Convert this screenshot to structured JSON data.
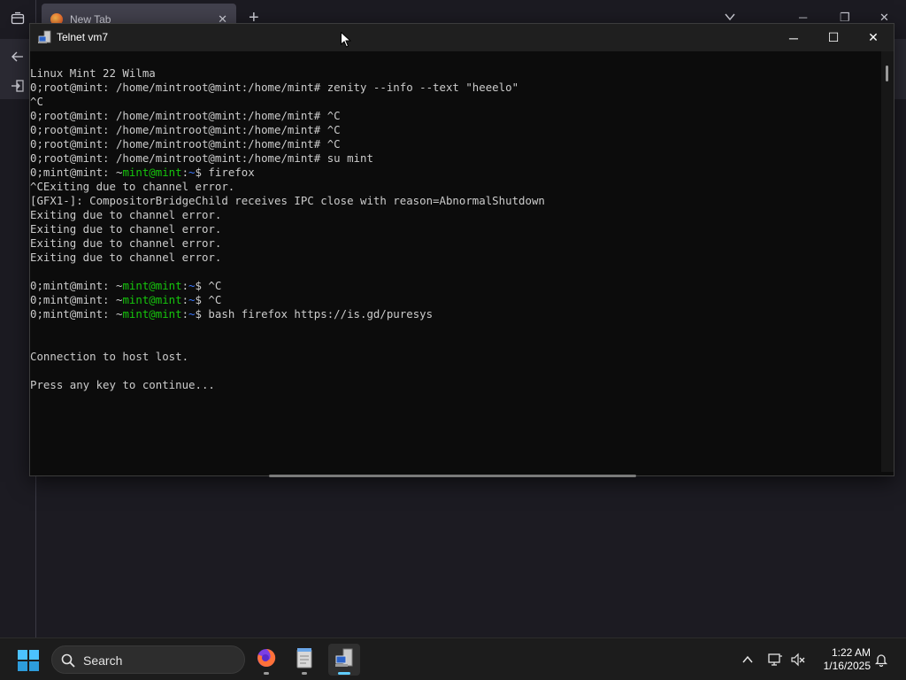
{
  "browser": {
    "tab_label": "New Tab",
    "tab_close": "✕",
    "new_tab": "+",
    "win_min": "─",
    "win_restore": "❐",
    "win_close": "✕"
  },
  "telnet": {
    "title": "Telnet vm7",
    "btn_minimize": "─",
    "btn_maximize": "☐",
    "btn_close": "✕",
    "lines": [
      [
        {
          "t": "Linux Mint 22 Wilma",
          "c": ""
        }
      ],
      [
        {
          "t": "0;root@mint: /home/mintroot@mint:/home/mint# zenity --info --text \"heeelo\"",
          "c": ""
        }
      ],
      [
        {
          "t": "^C",
          "c": ""
        }
      ],
      [
        {
          "t": "0;root@mint: /home/mintroot@mint:/home/mint# ^C",
          "c": ""
        }
      ],
      [
        {
          "t": "0;root@mint: /home/mintroot@mint:/home/mint# ^C",
          "c": ""
        }
      ],
      [
        {
          "t": "0;root@mint: /home/mintroot@mint:/home/mint# ^C",
          "c": ""
        }
      ],
      [
        {
          "t": "0;root@mint: /home/mintroot@mint:/home/mint# su mint",
          "c": ""
        }
      ],
      [
        {
          "t": "0;mint@mint: ~",
          "c": ""
        },
        {
          "t": "mint@mint",
          "c": "green"
        },
        {
          "t": ":",
          "c": ""
        },
        {
          "t": "~",
          "c": "blue"
        },
        {
          "t": "$ firefox",
          "c": ""
        }
      ],
      [
        {
          "t": "^CExiting due to channel error.",
          "c": ""
        }
      ],
      [
        {
          "t": "[GFX1-]: CompositorBridgeChild receives IPC close with reason=AbnormalShutdown",
          "c": ""
        }
      ],
      [
        {
          "t": "Exiting due to channel error.",
          "c": ""
        }
      ],
      [
        {
          "t": "Exiting due to channel error.",
          "c": ""
        }
      ],
      [
        {
          "t": "Exiting due to channel error.",
          "c": ""
        }
      ],
      [
        {
          "t": "Exiting due to channel error.",
          "c": ""
        }
      ],
      [
        {
          "t": "",
          "c": ""
        }
      ],
      [
        {
          "t": "0;mint@mint: ~",
          "c": ""
        },
        {
          "t": "mint@mint",
          "c": "green"
        },
        {
          "t": ":",
          "c": ""
        },
        {
          "t": "~",
          "c": "blue"
        },
        {
          "t": "$ ^C",
          "c": ""
        }
      ],
      [
        {
          "t": "0;mint@mint: ~",
          "c": ""
        },
        {
          "t": "mint@mint",
          "c": "green"
        },
        {
          "t": ":",
          "c": ""
        },
        {
          "t": "~",
          "c": "blue"
        },
        {
          "t": "$ ^C",
          "c": ""
        }
      ],
      [
        {
          "t": "0;mint@mint: ~",
          "c": ""
        },
        {
          "t": "mint@mint",
          "c": "green"
        },
        {
          "t": ":",
          "c": ""
        },
        {
          "t": "~",
          "c": "blue"
        },
        {
          "t": "$ bash firefox https://is.gd/puresys",
          "c": ""
        }
      ],
      [
        {
          "t": "",
          "c": ""
        }
      ],
      [
        {
          "t": "",
          "c": ""
        }
      ],
      [
        {
          "t": "Connection to host lost.",
          "c": ""
        }
      ],
      [
        {
          "t": "",
          "c": ""
        }
      ],
      [
        {
          "t": "Press any key to continue...",
          "c": ""
        }
      ]
    ]
  },
  "taskbar": {
    "search_label": "Search",
    "apps": [
      {
        "name": "firefox-icon",
        "active": false
      },
      {
        "name": "notepad-icon",
        "active": false
      },
      {
        "name": "telnet-icon",
        "active": true
      }
    ],
    "clock_time": "1:22 AM",
    "clock_date": "1/16/2025"
  },
  "colors": {
    "terminal_bg": "#0c0c0c",
    "terminal_fg": "#cccccc",
    "prompt_user": "#16c60c",
    "prompt_path": "#3b78ff",
    "accent": "#60cdff"
  }
}
